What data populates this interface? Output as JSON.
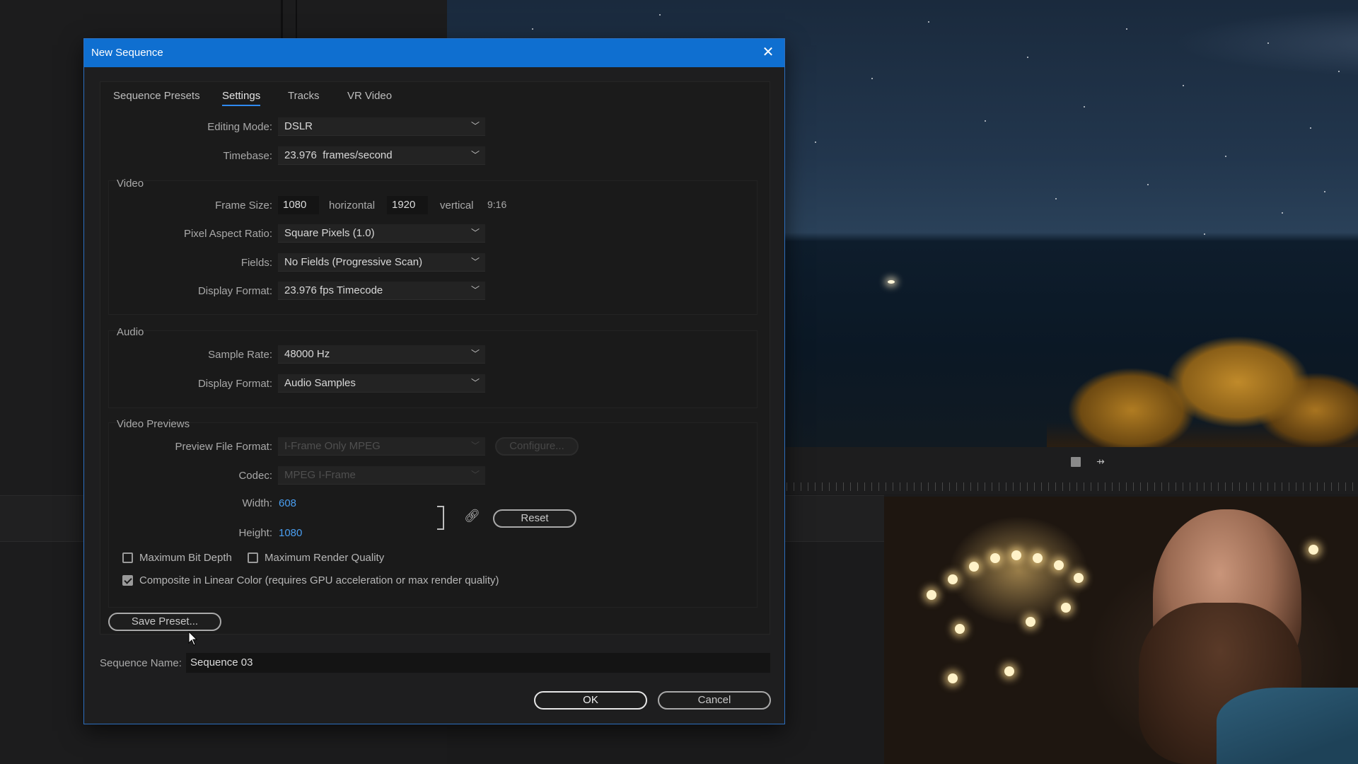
{
  "dialog": {
    "title": "New Sequence",
    "tabs": [
      "Sequence Presets",
      "Settings",
      "Tracks",
      "VR Video"
    ],
    "active_tab": "Settings",
    "editing_mode": {
      "label": "Editing Mode:",
      "value": "DSLR"
    },
    "timebase": {
      "label": "Timebase:",
      "value": "23.976  frames/second"
    },
    "video": {
      "section": "Video",
      "frame_size_label": "Frame Size:",
      "frame_width": "1080",
      "horizontal_label": "horizontal",
      "frame_height": "1920",
      "vertical_label": "vertical",
      "aspect": "9:16",
      "pixel_aspect_label": "Pixel Aspect Ratio:",
      "pixel_aspect_value": "Square Pixels (1.0)",
      "fields_label": "Fields:",
      "fields_value": "No Fields (Progressive Scan)",
      "display_format_label": "Display Format:",
      "display_format_value": "23.976 fps Timecode"
    },
    "audio": {
      "section": "Audio",
      "sample_rate_label": "Sample Rate:",
      "sample_rate_value": "48000 Hz",
      "display_format_label": "Display Format:",
      "display_format_value": "Audio Samples"
    },
    "previews": {
      "section": "Video Previews",
      "file_format_label": "Preview File Format:",
      "file_format_value": "I-Frame Only MPEG",
      "configure_label": "Configure...",
      "codec_label": "Codec:",
      "codec_value": "MPEG I-Frame",
      "width_label": "Width:",
      "width_value": "608",
      "height_label": "Height:",
      "height_value": "1080",
      "reset_label": "Reset"
    },
    "checkboxes": {
      "max_bit_depth": {
        "label": "Maximum Bit Depth",
        "checked": false
      },
      "max_render_quality": {
        "label": "Maximum Render Quality",
        "checked": false
      },
      "linear_color": {
        "label": "Composite in Linear Color (requires GPU acceleration or max render quality)",
        "checked": true
      }
    },
    "save_preset_label": "Save Preset...",
    "sequence_name_label": "Sequence Name:",
    "sequence_name_value": "Sequence 03",
    "ok_label": "OK",
    "cancel_label": "Cancel"
  },
  "icons": {
    "close": "close-icon",
    "chevron": "chevron-down-icon",
    "link": "link-icon"
  },
  "colors": {
    "titlebar": "#0f6fd0",
    "accent_tab": "#2f8af0",
    "value_blue": "#4a9ef0"
  }
}
